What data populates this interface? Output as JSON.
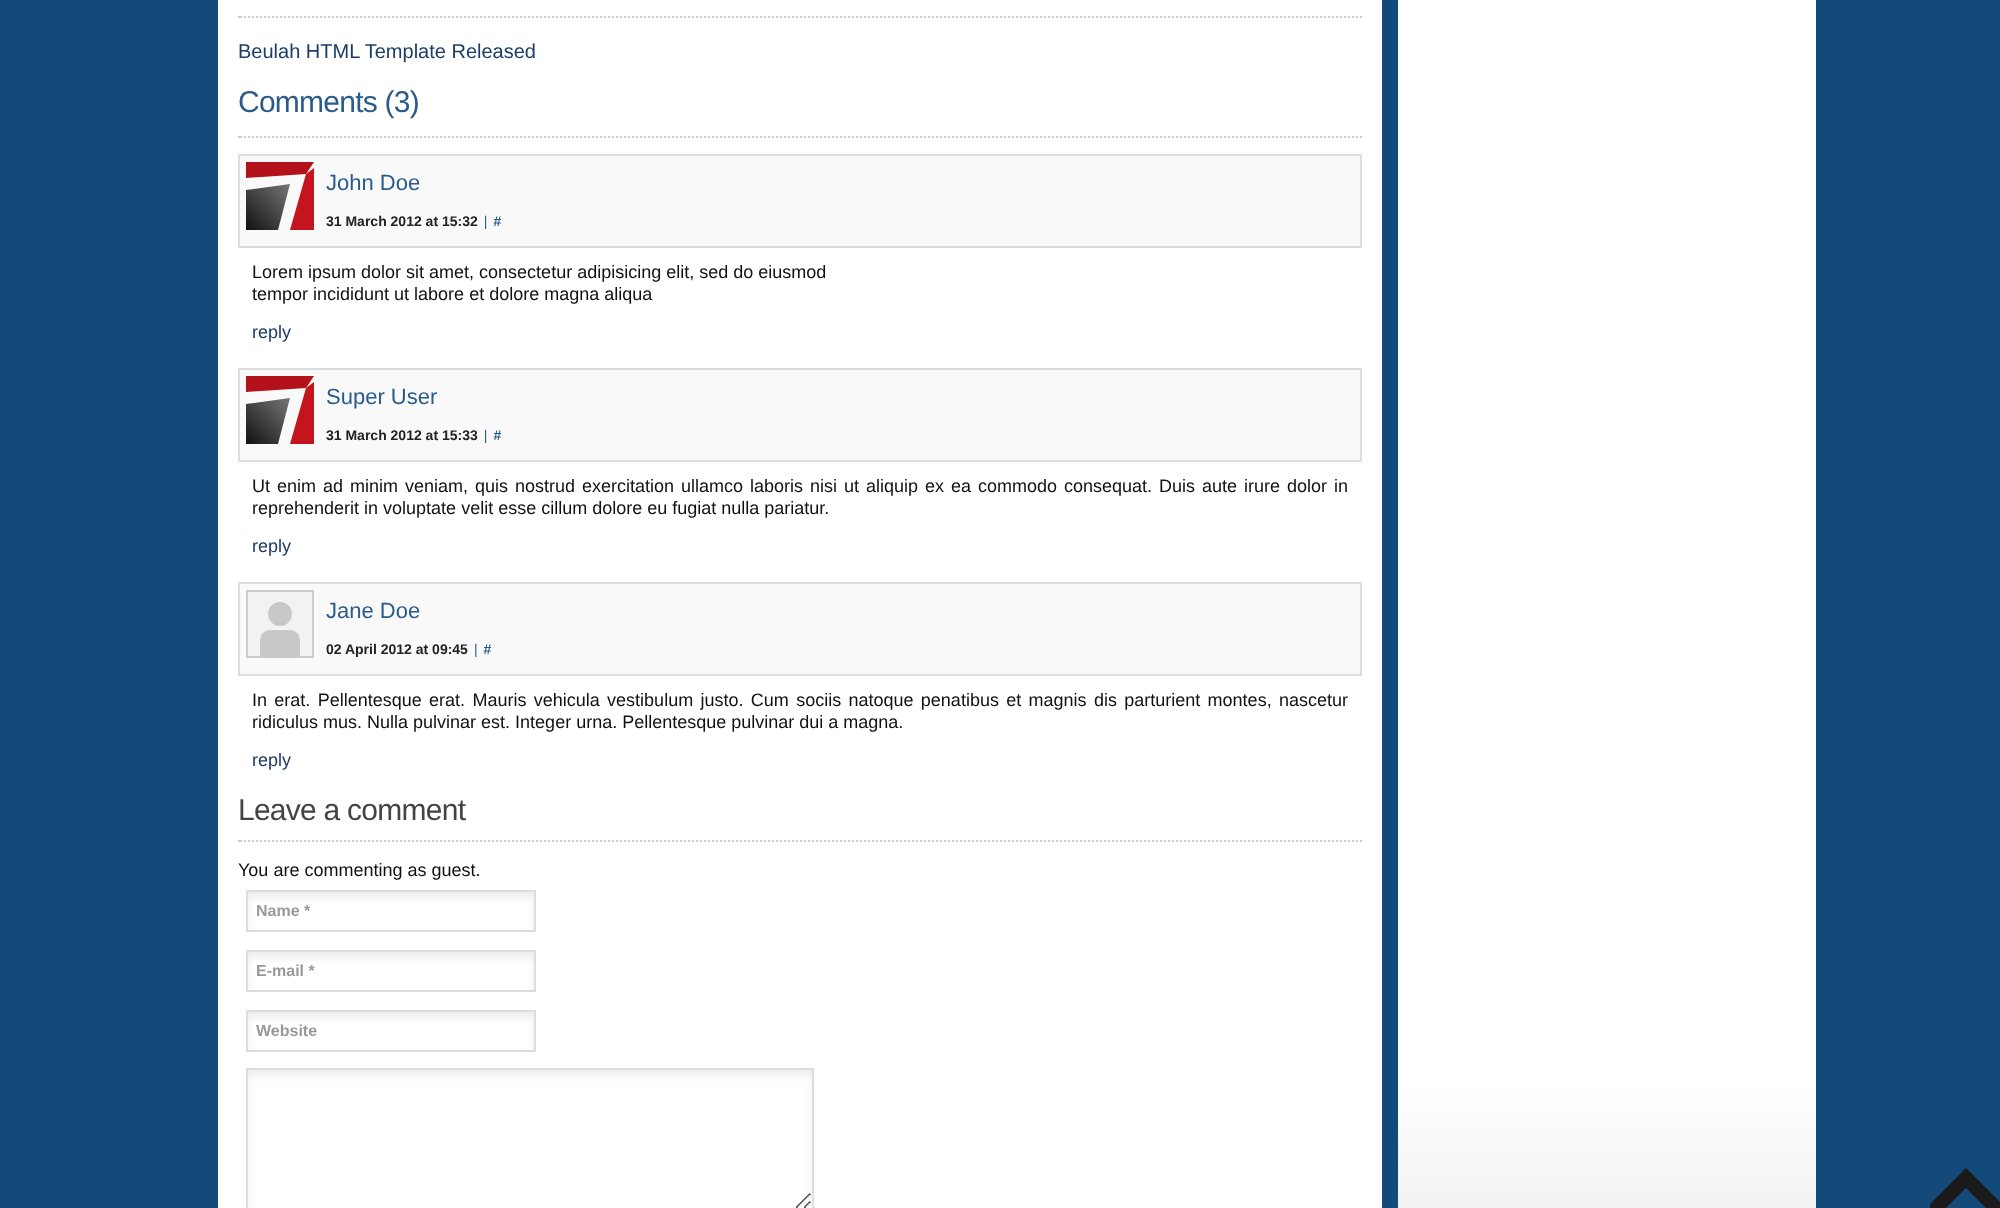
{
  "post_link": "Beulah HTML Template Released",
  "comments_title": "Comments (3)",
  "comments": [
    {
      "author": "John Doe",
      "kind": "logo",
      "date": "31 March 2012 at 15:32",
      "separator": "|",
      "permalink": "#",
      "text": "Lorem ipsum dolor sit amet, consectetur adipisicing elit, sed do eiusmod\ntempor incididunt ut labore et dolore magna aliqua",
      "reply": "reply"
    },
    {
      "author": "Super User",
      "kind": "logo",
      "date": "31 March 2012 at 15:33",
      "separator": "|",
      "permalink": "#",
      "text": "Ut enim ad minim veniam, quis nostrud exercitation ullamco laboris nisi ut aliquip ex ea commodo consequat. Duis aute irure dolor in reprehenderit in voluptate velit esse cillum dolore eu fugiat nulla pariatur.",
      "reply": "reply"
    },
    {
      "author": "Jane Doe",
      "kind": "silhouette",
      "date": "02 April 2012 at 09:45",
      "separator": "|",
      "permalink": "#",
      "text": "In erat. Pellentesque erat. Mauris vehicula vestibulum justo. Cum sociis natoque penatibus et magnis dis parturient montes, nascetur ridiculus mus. Nulla pulvinar est. Integer urna. Pellentesque pulvinar dui a magna.",
      "reply": "reply"
    }
  ],
  "form": {
    "title": "Leave a comment",
    "note": "You are commenting as guest.",
    "fields": [
      {
        "placeholder": "Name *"
      },
      {
        "placeholder": "E-mail *"
      },
      {
        "placeholder": "Website"
      }
    ]
  }
}
